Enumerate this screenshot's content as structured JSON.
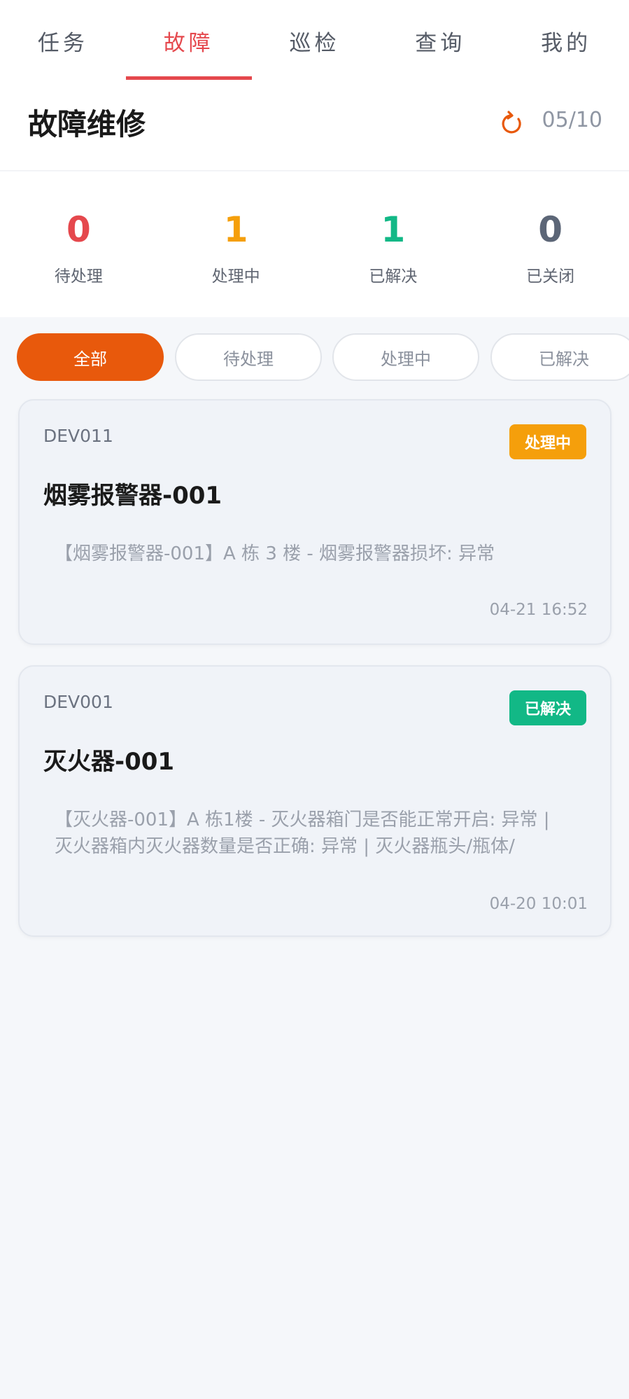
{
  "tabs": [
    {
      "label": "任务",
      "active": false
    },
    {
      "label": "故障",
      "active": true
    },
    {
      "label": "巡检",
      "active": false
    },
    {
      "label": "查询",
      "active": false
    },
    {
      "label": "我的",
      "active": false
    }
  ],
  "header": {
    "title": "故障维修",
    "refresh_icon": "refresh-icon",
    "date": "05/10"
  },
  "stats": [
    {
      "value": "0",
      "label": "待处理",
      "color": "#e5484d"
    },
    {
      "value": "1",
      "label": "处理中",
      "color": "#f59f0b"
    },
    {
      "value": "1",
      "label": "已解决",
      "color": "#12b886"
    },
    {
      "value": "0",
      "label": "已关闭",
      "color": "#5c6677"
    }
  ],
  "filters": [
    {
      "label": "全部",
      "active": true
    },
    {
      "label": "待处理",
      "active": false
    },
    {
      "label": "处理中",
      "active": false
    },
    {
      "label": "已解决",
      "active": false
    }
  ],
  "cards": [
    {
      "code": "DEV011",
      "status": "处理中",
      "status_color": "#f59f0b",
      "title": "烟雾报警器-001",
      "desc": "【烟雾报警器-001】A 栋 3 楼 - 烟雾报警器损坏: 异常",
      "time": "04-21 16:52"
    },
    {
      "code": "DEV001",
      "status": "已解决",
      "status_color": "#12b886",
      "title": "灭火器-001",
      "desc": "【灭火器-001】A 栋1楼 - 灭火器箱门是否能正常开启: 异常 | 灭火器箱内灭火器数量是否正确: 异常 | 灭火器瓶头/瓶体/",
      "time": "04-20 10:01"
    }
  ]
}
